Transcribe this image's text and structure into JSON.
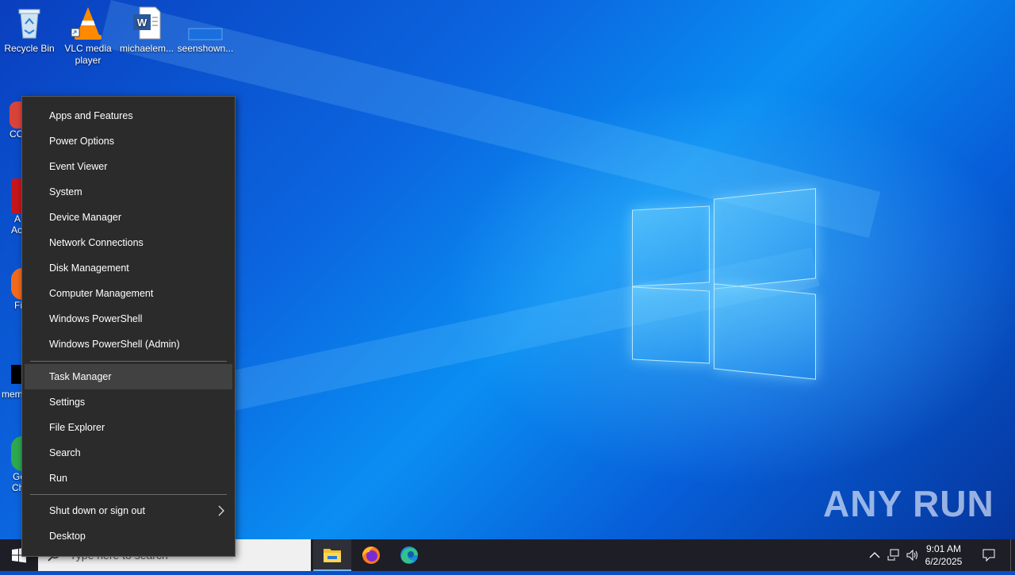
{
  "desktop": {
    "icons": [
      {
        "label": "Recycle Bin",
        "icon": "recycle-bin-icon"
      },
      {
        "label": "VLC media player",
        "icon": "vlc-icon"
      },
      {
        "label": "michaelem...",
        "icon": "word-document-icon"
      },
      {
        "label": "seenshown...",
        "icon": "blank-file-icon"
      }
    ],
    "partial_labels": [
      "CC",
      "A",
      "Ac",
      "Fi",
      "mem",
      "Go",
      "Ch"
    ]
  },
  "winx_menu": {
    "group1": [
      "Apps and Features",
      "Power Options",
      "Event Viewer",
      "System",
      "Device Manager",
      "Network Connections",
      "Disk Management",
      "Computer Management",
      "Windows PowerShell",
      "Windows PowerShell (Admin)"
    ],
    "group2": [
      "Task Manager",
      "Settings",
      "File Explorer",
      "Search",
      "Run"
    ],
    "group3": [
      "Shut down or sign out",
      "Desktop"
    ],
    "hovered_item": "Task Manager"
  },
  "taskbar": {
    "search_placeholder": "Type here to search",
    "pinned": [
      "file-explorer-icon",
      "firefox-icon",
      "edge-icon"
    ],
    "clock": {
      "time": "9:01 AM",
      "date": "6/2/2025"
    }
  },
  "watermark": "ANY RUN",
  "colors": {
    "menu_bg": "#2b2b2b",
    "menu_hover": "#414141",
    "taskbar": "#1e1e26",
    "accent": "#76b9ed"
  }
}
